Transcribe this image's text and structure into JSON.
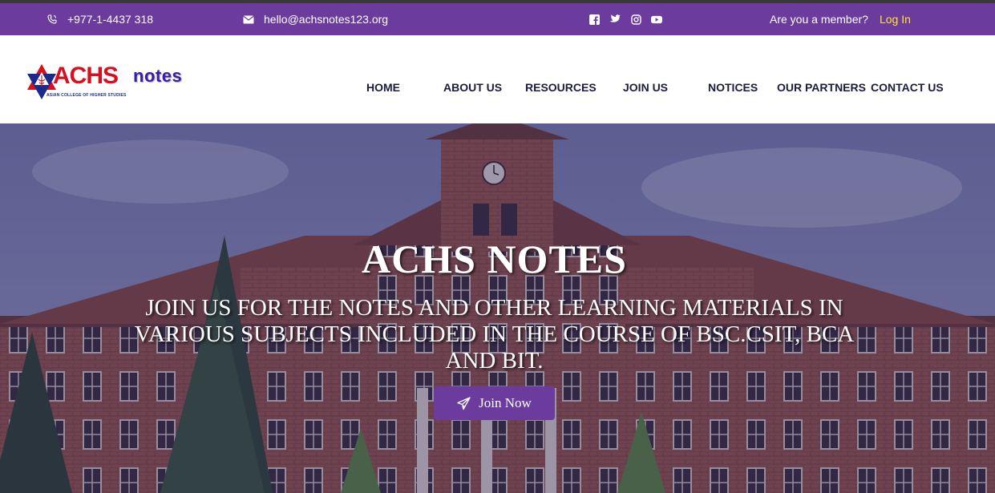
{
  "topbar": {
    "phone": "+977-1-4437 318",
    "email": "hello@achsnotes123.org",
    "socials": [
      "facebook-icon",
      "twitter-icon",
      "instagram-icon",
      "youtube-icon"
    ],
    "member_prompt": "Are you a member?",
    "login_label": "Log In"
  },
  "logo": {
    "brand": "ACHS",
    "tagline": "ASIAN COLLEGE OF HIGHER STUDIES",
    "notes": "notes"
  },
  "nav": {
    "items": [
      "HOME",
      "ABOUT US",
      "RESOURCES",
      "JOIN US",
      "NOTICES",
      "OUR PARTNERS",
      "CONTACT US"
    ]
  },
  "hero": {
    "title": "ACHS NOTES",
    "subtitle": "JOIN US FOR THE NOTES AND OTHER LEARNING MATERIALS IN VARIOUS SUBJECTS INCLUDED IN THE COURSE OF BSC.CSIT, BCA AND BIT.",
    "cta_label": "Join Now"
  },
  "colors": {
    "brand_purple": "#6b3c9e",
    "login_yellow": "#ffe82a",
    "logo_red": "#d6101e",
    "logo_blue": "#3a1fa5"
  }
}
